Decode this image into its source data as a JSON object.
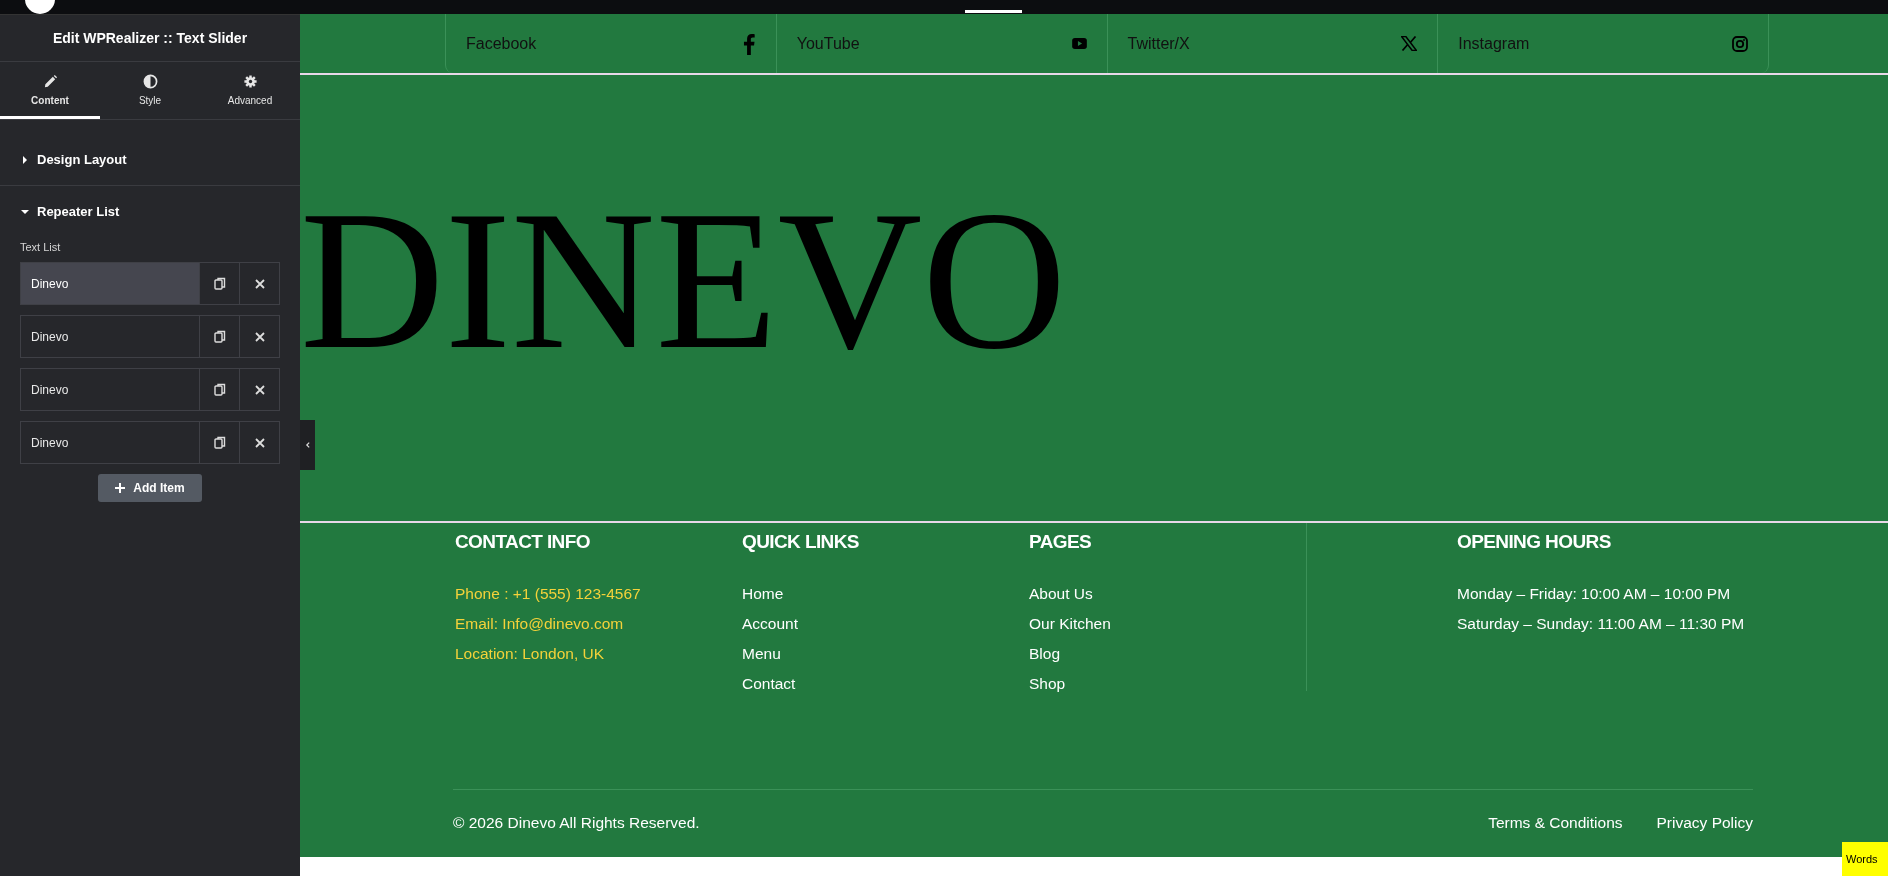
{
  "panel": {
    "title": "Edit WPRealizer :: Text Slider",
    "tabs": [
      {
        "label": "Content",
        "kind": "pencil",
        "selected": true
      },
      {
        "label": "Style",
        "kind": "contrast",
        "selected": false
      },
      {
        "label": "Advanced",
        "kind": "gear",
        "selected": false
      }
    ],
    "sections": [
      {
        "label": "Design Layout",
        "expanded": false
      },
      {
        "label": "Repeater List",
        "expanded": true
      }
    ],
    "list_label": "Text List",
    "items": [
      {
        "text": "Dinevo",
        "selected": true
      },
      {
        "text": "Dinevo",
        "selected": false
      },
      {
        "text": "Dinevo",
        "selected": false
      },
      {
        "text": "Dinevo",
        "selected": false
      }
    ],
    "add_button": "Add Item"
  },
  "social_links": [
    {
      "label": "Facebook",
      "kind": "facebook"
    },
    {
      "label": "YouTube",
      "kind": "youtube"
    },
    {
      "label": "Twitter/X",
      "kind": "x"
    },
    {
      "label": "Instagram",
      "kind": "instagram"
    }
  ],
  "slider_text": "DINEVO",
  "footer": {
    "columns": [
      {
        "heading": "CONTACT INFO",
        "kind": "contact",
        "items": [
          "Phone : +1 (555) 123-4567",
          "Email: Info@dinevo.com",
          "Location: London, UK"
        ]
      },
      {
        "heading": "QUICK LINKS",
        "kind": "links",
        "items": [
          "Home",
          "Account",
          "Menu",
          "Contact"
        ]
      },
      {
        "heading": "PAGES",
        "kind": "links",
        "items": [
          "About Us",
          "Our Kitchen",
          "Blog",
          "Shop"
        ]
      },
      {
        "heading": "OPENING HOURS",
        "kind": "hours",
        "items": [
          "Monday – Friday: 10:00 AM – 10:00 PM",
          "Saturday – Sunday: 11:00 AM – 11:30 PM"
        ]
      }
    ],
    "copyright": "© 2026 Dinevo All Rights Reserved.",
    "links": [
      "Terms & Conditions",
      "Privacy Policy"
    ]
  },
  "badge": "Words"
}
